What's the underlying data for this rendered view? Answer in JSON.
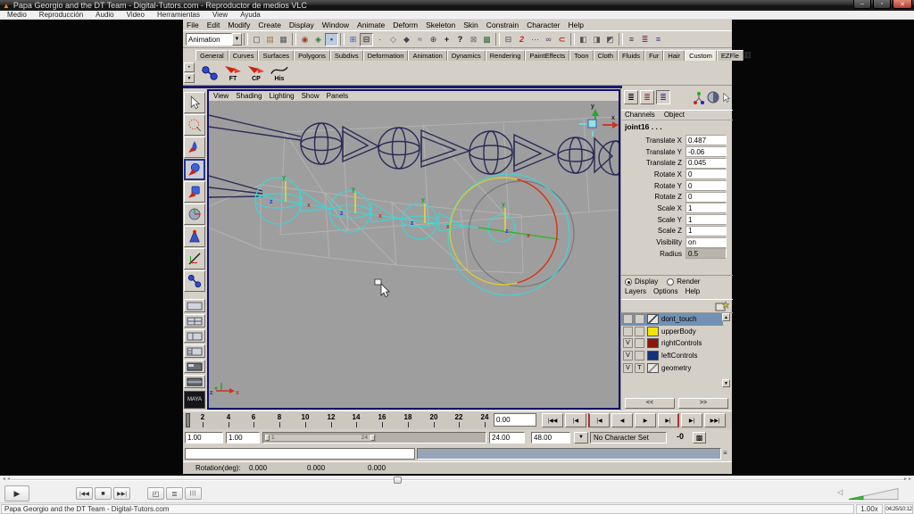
{
  "vlc": {
    "title": "Papa Georgio and the DT Team - Digital-Tutors.com - Reproductor de medios VLC",
    "menu": [
      "Medio",
      "Reproducción",
      "Audio",
      "Video",
      "Herramientas",
      "View",
      "Ayuda"
    ],
    "status_text": "Papa Georgio and the DT Team - Digital-Tutors.com",
    "speed": "1.00x",
    "time": "04:25/10:12",
    "seek_position_pct": 43,
    "volume_pct": 30,
    "window_buttons": {
      "minimize": "–",
      "maximize": "▫",
      "close": "✕"
    },
    "controls": {
      "play": "▶",
      "previous": "|◀◀",
      "stop": "■",
      "next": "▶▶|"
    },
    "seek_left_arrow": "◄◄",
    "seek_right_arrow": "►►"
  },
  "icons": {
    "cone": "▲",
    "dd": "▼",
    "new_scene": "▢",
    "open_scene": "▤",
    "save_scene": "▦",
    "sel_hier": "◉",
    "sel_obj": "◈",
    "sel_comp": "▪",
    "snap_grid": "⊞",
    "snap_curve": "C",
    "snap_point": "∙",
    "snap_view": "◇",
    "snap_surf": "◆",
    "live": "≈",
    "input": "⊕",
    "construct": "+",
    "help": "?",
    "lock": "⊠",
    "hilite": "▩",
    "edit_box": "⊟",
    "two": "2",
    "dots": "⋯",
    "link": "∞",
    "magnet": "⊂",
    "render1": "◧",
    "render2": "◨",
    "render3": "◩",
    "tog1": "≡",
    "tog2": "≣",
    "tog3": "≡",
    "cb_list": "≣",
    "trash": "▥",
    "shelf_cycle": "‣",
    "shelf_menu": "▼",
    "cmd_menu": "≡",
    "playlist": "≣",
    "eq": "|||",
    "fullscreen": "◰",
    "speaker": "◁"
  },
  "maya": {
    "menu": [
      "File",
      "Edit",
      "Modify",
      "Create",
      "Display",
      "Window",
      "Animate",
      "Deform",
      "Skeleton",
      "Skin",
      "Constrain",
      "Character",
      "Help"
    ],
    "status_line": {
      "mode": "Animation"
    },
    "shelf_tabs": [
      "General",
      "Curves",
      "Surfaces",
      "Polygons",
      "Subdivs",
      "Deformation",
      "Animation",
      "Dynamics",
      "Rendering",
      "PaintEffects",
      "Toon",
      "Cloth",
      "Fluids",
      "Fur",
      "Hair",
      "Custom",
      "EZFle"
    ],
    "shelf_buttons": [
      {
        "label": "FT"
      },
      {
        "label": "CP"
      },
      {
        "label": "His"
      }
    ],
    "panel_menu": [
      "View",
      "Shading",
      "Lighting",
      "Show",
      "Panels"
    ],
    "viewport": {
      "axis": {
        "x": "x",
        "y": "y",
        "z": "z"
      }
    },
    "channel_box": {
      "tabs": [
        "Channels",
        "Object"
      ],
      "object_name": "joint16 . . .",
      "channels": [
        {
          "label": "Translate X",
          "value": "0.487"
        },
        {
          "label": "Translate Y",
          "value": "-0.06"
        },
        {
          "label": "Translate Z",
          "value": "0.045"
        },
        {
          "label": "Rotate X",
          "value": "0"
        },
        {
          "label": "Rotate Y",
          "value": "0"
        },
        {
          "label": "Rotate Z",
          "value": "0"
        },
        {
          "label": "Scale X",
          "value": "1"
        },
        {
          "label": "Scale Y",
          "value": "1"
        },
        {
          "label": "Scale Z",
          "value": "1"
        },
        {
          "label": "Visibility",
          "value": "on"
        },
        {
          "label": "Radius",
          "value": "0.5"
        }
      ]
    },
    "layer_editor": {
      "display_label": "Display",
      "render_label": "Render",
      "menu": [
        "Layers",
        "Options",
        "Help"
      ],
      "layers": [
        {
          "vis": "",
          "type": "",
          "name": "dont_touch",
          "color": "linear-gradient(135deg,#e9e7e1 44%,#4a4a4a 44%,#4a4a4a 56%,#e9e7e1 56%)"
        },
        {
          "vis": "",
          "type": "",
          "name": "upperBody",
          "color": "#f2e300"
        },
        {
          "vis": "V",
          "type": "",
          "name": "rightControls",
          "color": "#8a1806"
        },
        {
          "vis": "V",
          "type": "",
          "name": "leftControls",
          "color": "#14337d"
        },
        {
          "vis": "V",
          "type": "T",
          "name": "geometry",
          "color": "linear-gradient(135deg,#e9e7e1 44%,#8a8a8a 44%,#8a8a8a 56%,#e9e7e1 56%)"
        }
      ],
      "scroll_left": "<<",
      "scroll_right": ">>"
    },
    "timeline": {
      "ticks": [
        2,
        4,
        6,
        8,
        10,
        12,
        14,
        16,
        18,
        20,
        22,
        24
      ],
      "current_frame": "0.00",
      "playback": [
        "|◀◀",
        "|◀",
        "|◀",
        "◀",
        "▶",
        "▶|",
        "▶|",
        "▶▶|"
      ]
    },
    "range_bar": {
      "anim_start": "1.00",
      "playback_start": "1.00",
      "range_start_label": "1",
      "range_end_label": "24",
      "playback_end": "24.00",
      "anim_end": "48.00",
      "character_set": "No Character Set",
      "key_icon": "-0"
    },
    "help_line": {
      "label": "Rotation(deg):",
      "v1": "0.000",
      "v2": "0.000",
      "v3": "0.000"
    }
  }
}
